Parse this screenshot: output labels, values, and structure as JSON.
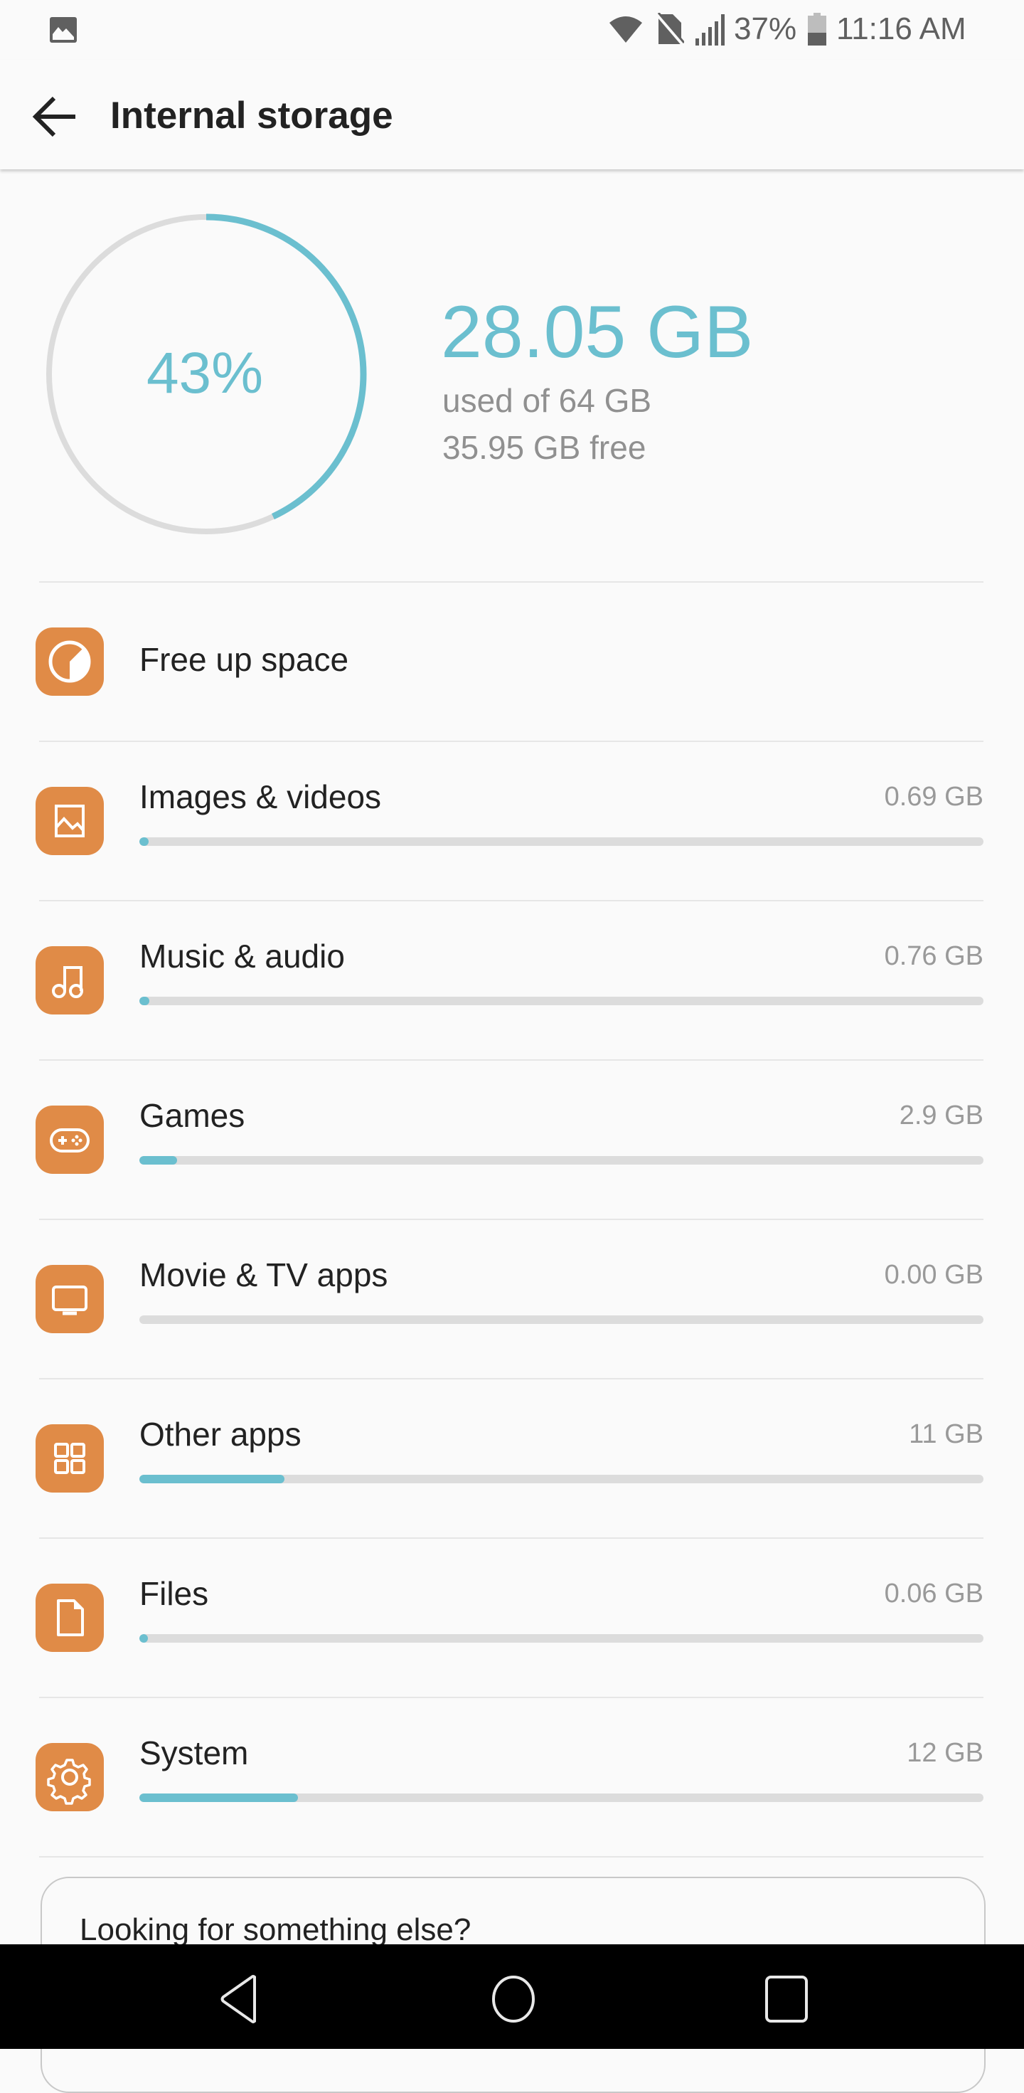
{
  "status_bar": {
    "notification_icon": "image-icon",
    "battery_percent": "37%",
    "time": "11:16 AM",
    "icons": [
      "wifi-icon",
      "no-sim-icon",
      "signal-icon",
      "battery-icon"
    ]
  },
  "header": {
    "back_icon": "arrow-left-icon",
    "title": "Internal storage"
  },
  "summary": {
    "percent_label": "43%",
    "percent_used": 0.43,
    "used": "28.05 GB",
    "used_of": "used of 64 GB",
    "free": "35.95 GB free",
    "accent_color": "#6bbfcf",
    "track_color": "#dcdcdc"
  },
  "free_up": {
    "label": "Free up space",
    "icon": "pie-clock-icon"
  },
  "categories": [
    {
      "label": "Images & videos",
      "value": "0.69 GB",
      "fraction": 0.0108,
      "icon": "image-icon"
    },
    {
      "label": "Music & audio",
      "value": "0.76 GB",
      "fraction": 0.0119,
      "icon": "music-note-icon"
    },
    {
      "label": "Games",
      "value": "2.9 GB",
      "fraction": 0.045,
      "icon": "gamepad-icon"
    },
    {
      "label": "Movie & TV apps",
      "value": "0.00 GB",
      "fraction": 0.0,
      "icon": "tv-icon"
    },
    {
      "label": "Other apps",
      "value": "11 GB",
      "fraction": 0.172,
      "icon": "grid-icon"
    },
    {
      "label": "Files",
      "value": "0.06 GB",
      "fraction": 0.0009,
      "icon": "file-icon"
    },
    {
      "label": "System",
      "value": "12 GB",
      "fraction": 0.1875,
      "icon": "gear-icon"
    }
  ],
  "card": {
    "title": "Looking for something else?"
  },
  "nav_bar": {
    "buttons": [
      "back",
      "home",
      "recents"
    ]
  }
}
